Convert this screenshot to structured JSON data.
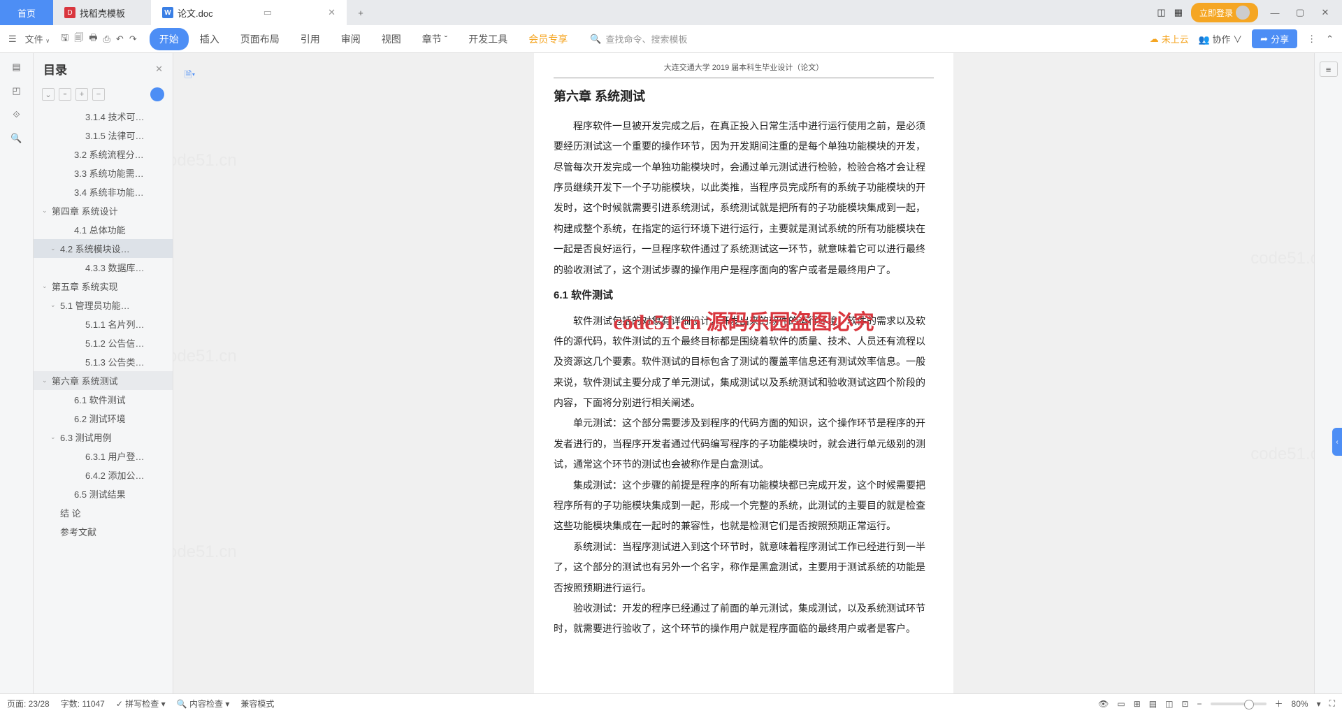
{
  "tabs": {
    "home": "首页",
    "template": "找稻壳模板",
    "doc": "论文.doc",
    "add": "+"
  },
  "titlebar": {
    "login": "立即登录"
  },
  "quick": {
    "file_label": "文件"
  },
  "menu": {
    "start": "开始",
    "insert": "插入",
    "layout": "页面布局",
    "ref": "引用",
    "review": "审阅",
    "view": "视图",
    "chapter": "章节",
    "devtool": "开发工具",
    "vip": "会员专享"
  },
  "search": {
    "placeholder": "查找命令、搜索模板"
  },
  "ribbon_right": {
    "nocloud": "未上云",
    "collab": "协作",
    "share": "分享"
  },
  "outline": {
    "title": "目录",
    "items": [
      {
        "label": "3.1.4 技术可…",
        "indent": 3,
        "caret": ""
      },
      {
        "label": "3.1.5 法律可…",
        "indent": 3,
        "caret": ""
      },
      {
        "label": "3.2 系统流程分…",
        "indent": 2,
        "caret": ""
      },
      {
        "label": "3.3 系统功能需…",
        "indent": 2,
        "caret": ""
      },
      {
        "label": "3.4 系统非功能…",
        "indent": 2,
        "caret": ""
      },
      {
        "label": "第四章   系统设计",
        "indent": 0,
        "caret": "v"
      },
      {
        "label": "4.1 总体功能",
        "indent": 2,
        "caret": ""
      },
      {
        "label": "4.2  系统模块设…",
        "indent": 1,
        "caret": "v",
        "sel": true
      },
      {
        "label": "4.3.3 数据库…",
        "indent": 3,
        "caret": ""
      },
      {
        "label": "第五章  系统实现",
        "indent": 0,
        "caret": "v"
      },
      {
        "label": "5.1 管理员功能…",
        "indent": 1,
        "caret": "v"
      },
      {
        "label": "5.1.1 名片列…",
        "indent": 3,
        "caret": ""
      },
      {
        "label": "5.1.2 公告信…",
        "indent": 3,
        "caret": ""
      },
      {
        "label": "5.1.3 公告类…",
        "indent": 3,
        "caret": ""
      },
      {
        "label": "第六章  系统测试",
        "indent": 0,
        "caret": "v",
        "cur": true
      },
      {
        "label": "6.1 软件测试",
        "indent": 2,
        "caret": ""
      },
      {
        "label": "6.2 测试环境",
        "indent": 2,
        "caret": ""
      },
      {
        "label": "6.3  测试用例",
        "indent": 1,
        "caret": "v"
      },
      {
        "label": "6.3.1 用户登…",
        "indent": 3,
        "caret": ""
      },
      {
        "label": "6.4.2 添加公…",
        "indent": 3,
        "caret": ""
      },
      {
        "label": "6.5 测试结果",
        "indent": 2,
        "caret": ""
      },
      {
        "label": "结   论",
        "indent": 1,
        "caret": ""
      },
      {
        "label": "参考文献",
        "indent": 1,
        "caret": ""
      }
    ]
  },
  "doc": {
    "page_header": "大连交通大学 2019 届本科生毕业设计（论文）",
    "h1": "第六章  系统测试",
    "p1": "程序软件一旦被开发完成之后，在真正投入日常生活中进行运行使用之前，是必须要经历测试这一个重要的操作环节，因为开发期间注重的是每个单独功能模块的开发，尽管每次开发完成一个单独功能模块时，会通过单元测试进行检验，检验合格才会让程序员继续开发下一个子功能模块，以此类推，当程序员完成所有的系统子功能模块的开发时，这个时候就需要引进系统测试，系统测试就是把所有的子功能模块集成到一起，构建成整个系统，在指定的运行环境下进行运行，主要就是测试系统的所有功能模块在一起是否良好运行，一旦程序软件通过了系统测试这一环节，就意味着它可以进行最终的验收测试了，这个测试步骤的操作用户是程序面向的客户或者是最终用户了。",
    "h2": "6.1 软件测试",
    "p2": "软件测试包括的对象有详细设计，开发出来的软件的运行环境，软件的需求以及软件的源代码，软件测试的五个最终目标都是围绕着软件的质量、技术、人员还有流程以及资源这几个要素。软件测试的目标包含了测试的覆盖率信息还有测试效率信息。一般来说，软件测试主要分成了单元测试，集成测试以及系统测试和验收测试这四个阶段的内容，下面将分别进行相关阐述。",
    "p3": "单元测试：这个部分需要涉及到程序的代码方面的知识，这个操作环节是程序的开发者进行的，当程序开发者通过代码编写程序的子功能模块时，就会进行单元级别的测试，通常这个环节的测试也会被称作是白盒测试。",
    "p4": "集成测试：这个步骤的前提是程序的所有功能模块都已完成开发，这个时候需要把程序所有的子功能模块集成到一起，形成一个完整的系统，此测试的主要目的就是检查这些功能模块集成在一起时的兼容性，也就是检测它们是否按照预期正常运行。",
    "p5": "系统测试：当程序测试进入到这个环节时，就意味着程序测试工作已经进行到一半了，这个部分的测试也有另外一个名字，称作是黑盒测试，主要用于测试系统的功能是否按照预期进行运行。",
    "p6": "验收测试：开发的程序已经通过了前面的单元测试，集成测试，以及系统测试环节时，就需要进行验收了，这个环节的操作用户就是程序面临的最终用户或者是客户。"
  },
  "overlay_text": "code51.cn 源码乐园盗图必究",
  "watermark": "code51.cn",
  "status": {
    "page": "页面: 23/28",
    "words": "字数: 11047",
    "spellcheck": "拼写检查",
    "contentcheck": "内容检查",
    "compat": "兼容模式",
    "zoom": "80%"
  }
}
